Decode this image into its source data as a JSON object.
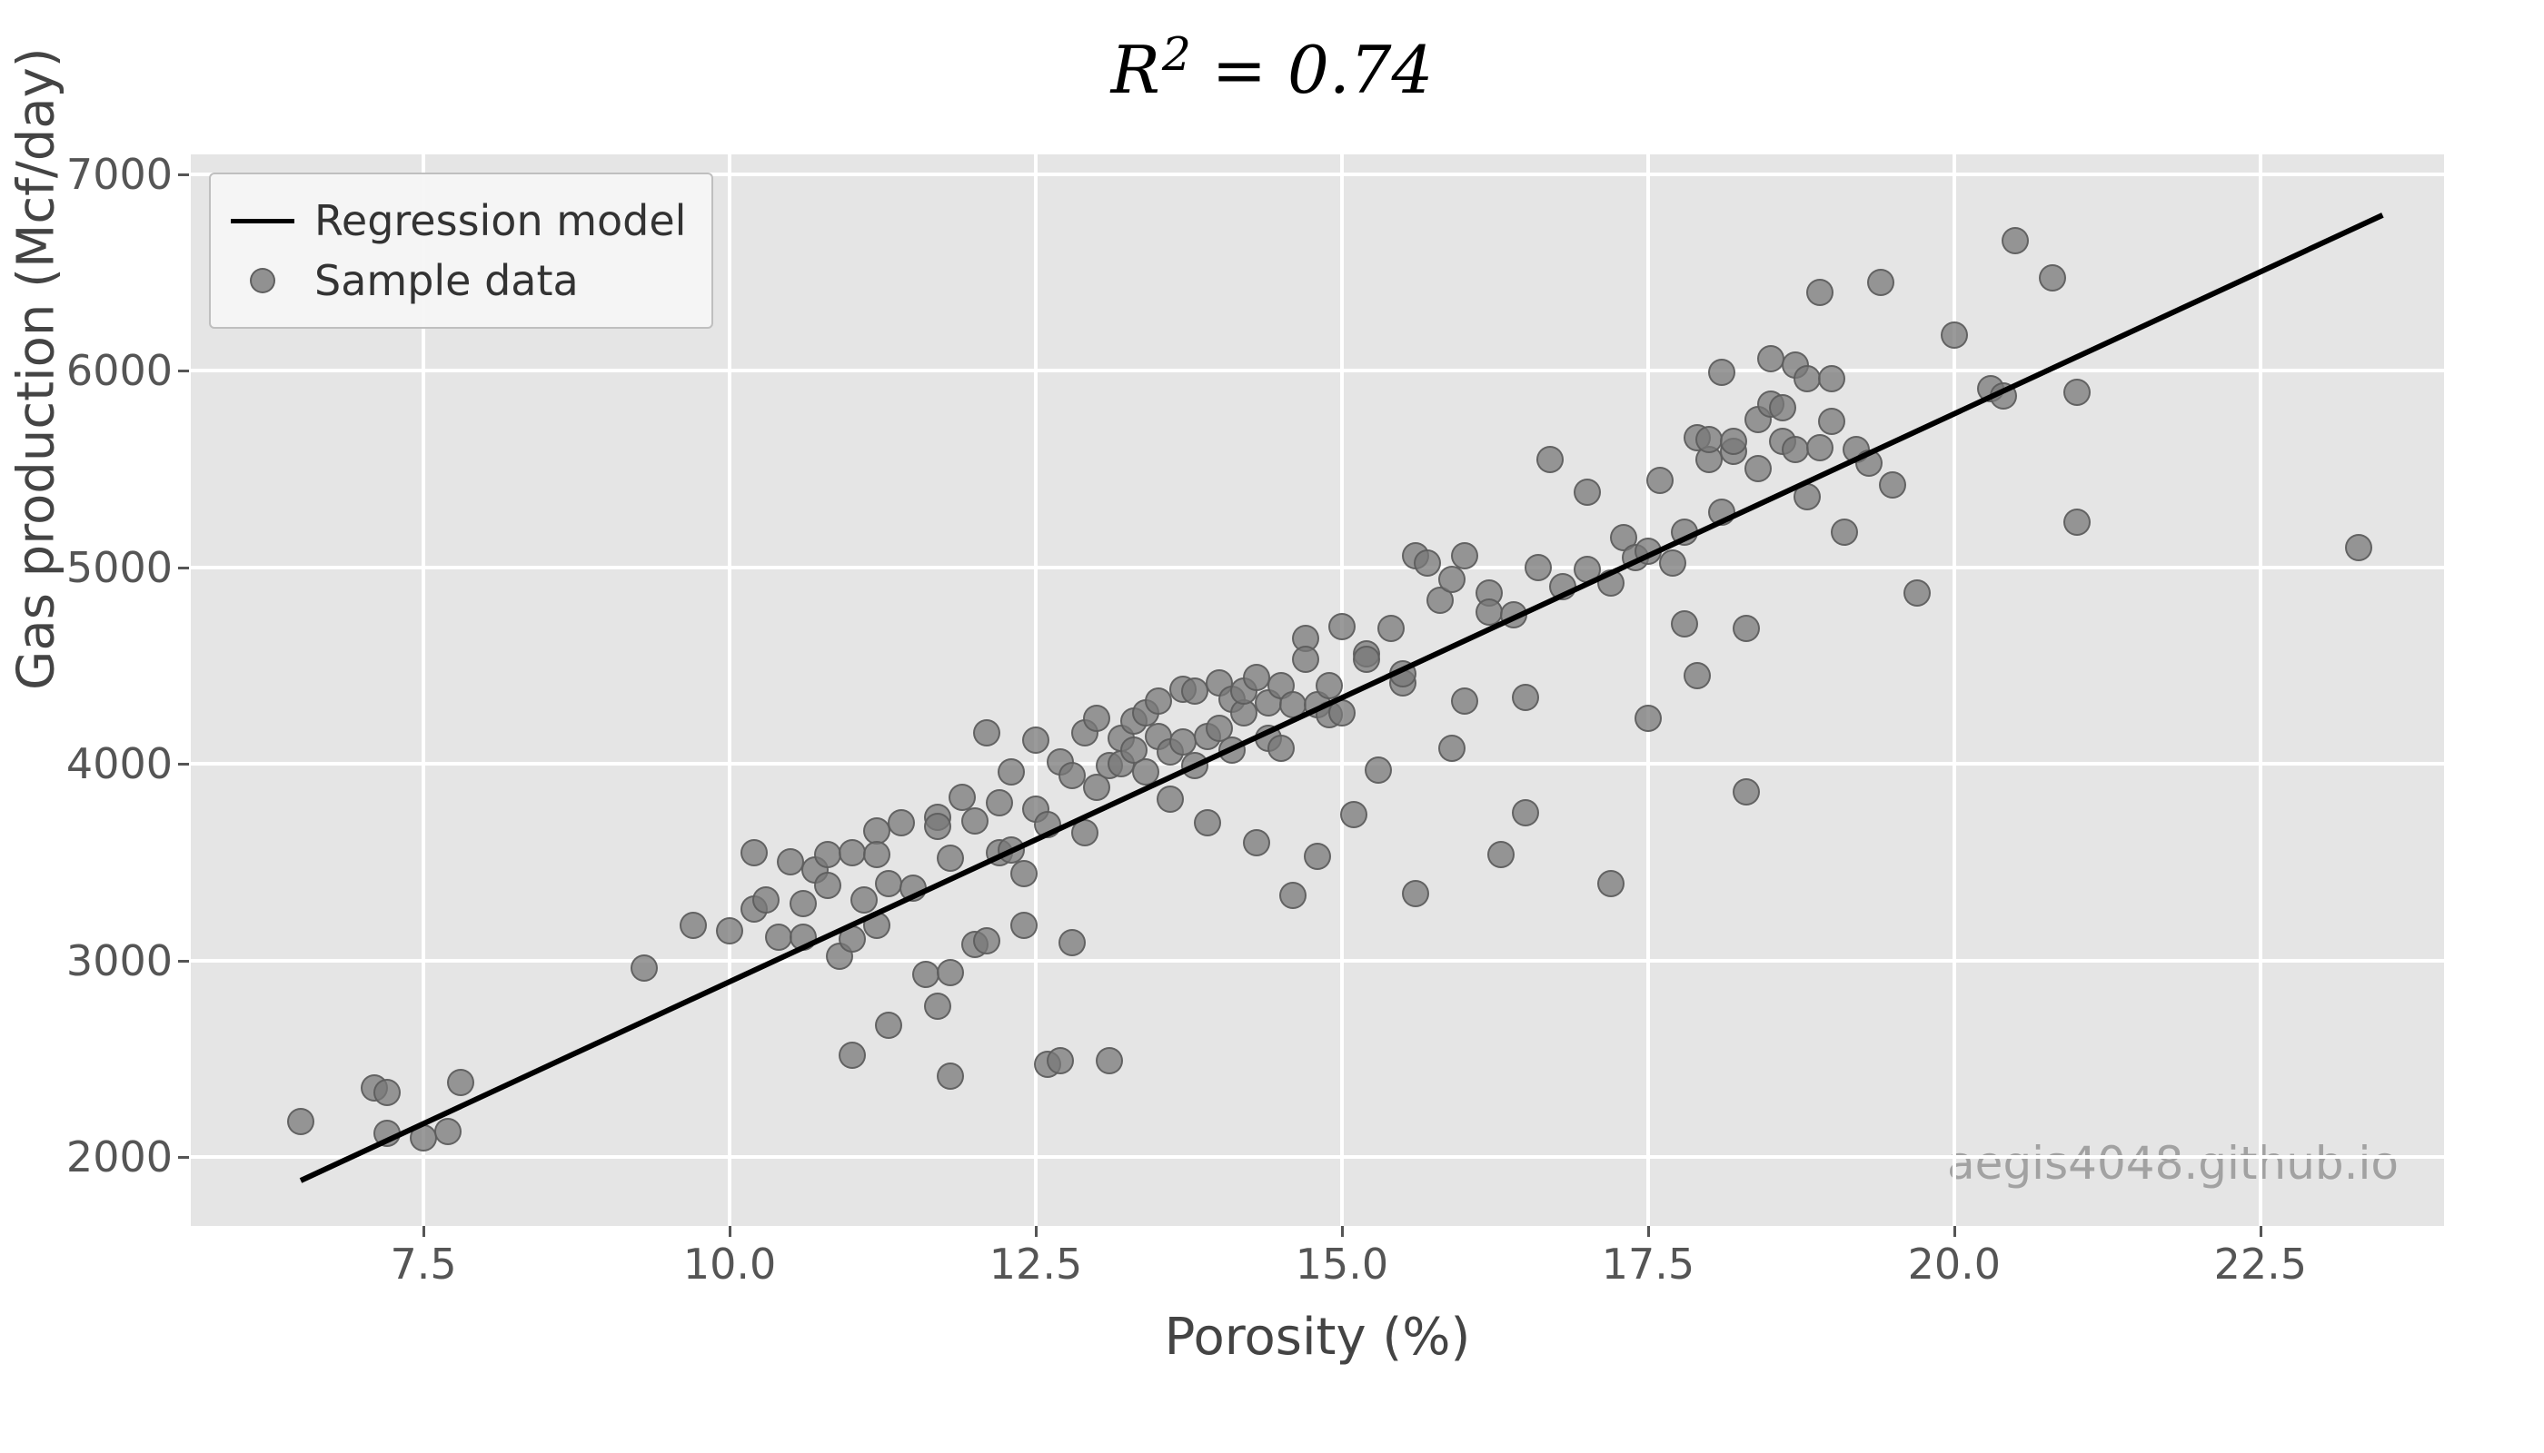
{
  "chart_data": {
    "type": "scatter",
    "title": "R² = 0.74",
    "xlabel": "Porosity (%)",
    "ylabel": "Gas production (Mcf/day)",
    "xlim": [
      5.6,
      24.0
    ],
    "ylim": [
      1650,
      7100
    ],
    "xticks": [
      7.5,
      10.0,
      12.5,
      15.0,
      17.5,
      20.0,
      22.5
    ],
    "yticks": [
      2000,
      3000,
      4000,
      5000,
      6000,
      7000
    ],
    "legend": {
      "position": "upper left",
      "entries": [
        {
          "label": "Regression model",
          "type": "line"
        },
        {
          "label": "Sample data",
          "type": "marker"
        }
      ]
    },
    "regression_line": {
      "x": [
        6.5,
        23.5
      ],
      "y": [
        1880,
        6790
      ]
    },
    "watermark": "aegis4048.github.io",
    "series": [
      {
        "name": "Sample data",
        "x": [
          6.5,
          7.1,
          7.2,
          7.5,
          7.2,
          7.8,
          7.7,
          9.3,
          9.7,
          10.0,
          10.2,
          10.2,
          10.3,
          10.4,
          10.5,
          10.6,
          10.6,
          10.7,
          10.8,
          10.8,
          10.9,
          11.0,
          11.0,
          11.0,
          11.1,
          11.2,
          11.2,
          11.2,
          11.3,
          11.3,
          11.4,
          11.5,
          11.6,
          11.7,
          11.7,
          11.7,
          11.8,
          11.8,
          11.8,
          11.9,
          12.0,
          12.0,
          12.1,
          12.1,
          12.2,
          12.2,
          12.3,
          12.3,
          12.4,
          12.4,
          12.5,
          12.5,
          12.6,
          12.6,
          12.7,
          12.7,
          12.8,
          12.8,
          12.9,
          12.9,
          13.0,
          13.0,
          13.1,
          13.1,
          13.2,
          13.2,
          13.3,
          13.3,
          13.4,
          13.4,
          13.5,
          13.5,
          13.6,
          13.6,
          13.7,
          13.7,
          13.8,
          13.8,
          13.9,
          13.9,
          14.0,
          14.0,
          14.1,
          14.1,
          14.2,
          14.2,
          14.3,
          14.3,
          14.4,
          14.4,
          14.5,
          14.5,
          14.6,
          14.6,
          14.7,
          14.7,
          14.8,
          14.8,
          14.9,
          14.9,
          15.0,
          15.0,
          15.1,
          15.2,
          15.2,
          15.3,
          15.4,
          15.5,
          15.5,
          15.6,
          15.6,
          15.7,
          15.8,
          15.9,
          15.9,
          16.0,
          16.0,
          16.2,
          16.2,
          16.3,
          16.4,
          16.5,
          16.5,
          16.6,
          16.7,
          16.8,
          17.0,
          17.0,
          17.2,
          17.2,
          17.3,
          17.4,
          17.5,
          17.5,
          17.6,
          17.7,
          17.8,
          17.8,
          17.9,
          17.9,
          18.0,
          18.0,
          18.1,
          18.1,
          18.2,
          18.2,
          18.3,
          18.3,
          18.4,
          18.4,
          18.5,
          18.5,
          18.6,
          18.6,
          18.7,
          18.7,
          18.8,
          18.8,
          18.9,
          18.9,
          19.0,
          19.0,
          19.1,
          19.2,
          19.3,
          19.4,
          19.5,
          19.7,
          20.0,
          20.3,
          20.4,
          20.5,
          20.8,
          21.0,
          21.0,
          23.3
        ],
        "y": [
          2180,
          2350,
          2330,
          2100,
          2120,
          2380,
          2130,
          2960,
          3180,
          3150,
          3550,
          3260,
          3310,
          3120,
          3500,
          3120,
          3290,
          3460,
          3380,
          3540,
          3020,
          3550,
          3110,
          2520,
          3310,
          3660,
          3180,
          3540,
          3390,
          2670,
          3700,
          3370,
          2930,
          3730,
          3680,
          2770,
          3520,
          2940,
          2410,
          3830,
          3710,
          3080,
          4160,
          3100,
          3800,
          3550,
          3960,
          3560,
          3440,
          3180,
          4120,
          3770,
          3690,
          2470,
          2490,
          4010,
          3940,
          3090,
          4160,
          3650,
          4230,
          3880,
          3990,
          2490,
          4000,
          4130,
          4070,
          4220,
          4260,
          3960,
          4320,
          4140,
          4060,
          3820,
          4110,
          4380,
          3990,
          4370,
          4140,
          3700,
          4410,
          4180,
          4330,
          4070,
          4260,
          4370,
          3600,
          4440,
          4130,
          4310,
          4080,
          4400,
          4300,
          3330,
          4640,
          4530,
          4300,
          3530,
          4250,
          4400,
          4260,
          4700,
          3740,
          4560,
          4530,
          3970,
          4690,
          4410,
          4460,
          3340,
          5060,
          5020,
          4830,
          4940,
          4080,
          5060,
          4320,
          4870,
          4770,
          3540,
          4760,
          4340,
          3750,
          5000,
          5550,
          4900,
          5380,
          4990,
          4920,
          3390,
          5150,
          5050,
          5080,
          4230,
          5440,
          5020,
          5180,
          4710,
          4450,
          5660,
          5550,
          5650,
          5990,
          5280,
          5590,
          5640,
          3860,
          4690,
          5750,
          5500,
          6060,
          5830,
          5810,
          5640,
          6030,
          5600,
          5960,
          5360,
          6400,
          5610,
          5740,
          5960,
          5180,
          5600,
          5530,
          6450,
          5420,
          4870,
          6180,
          5910,
          5870,
          6660,
          6470,
          5890,
          5230,
          5100
        ]
      }
    ]
  }
}
